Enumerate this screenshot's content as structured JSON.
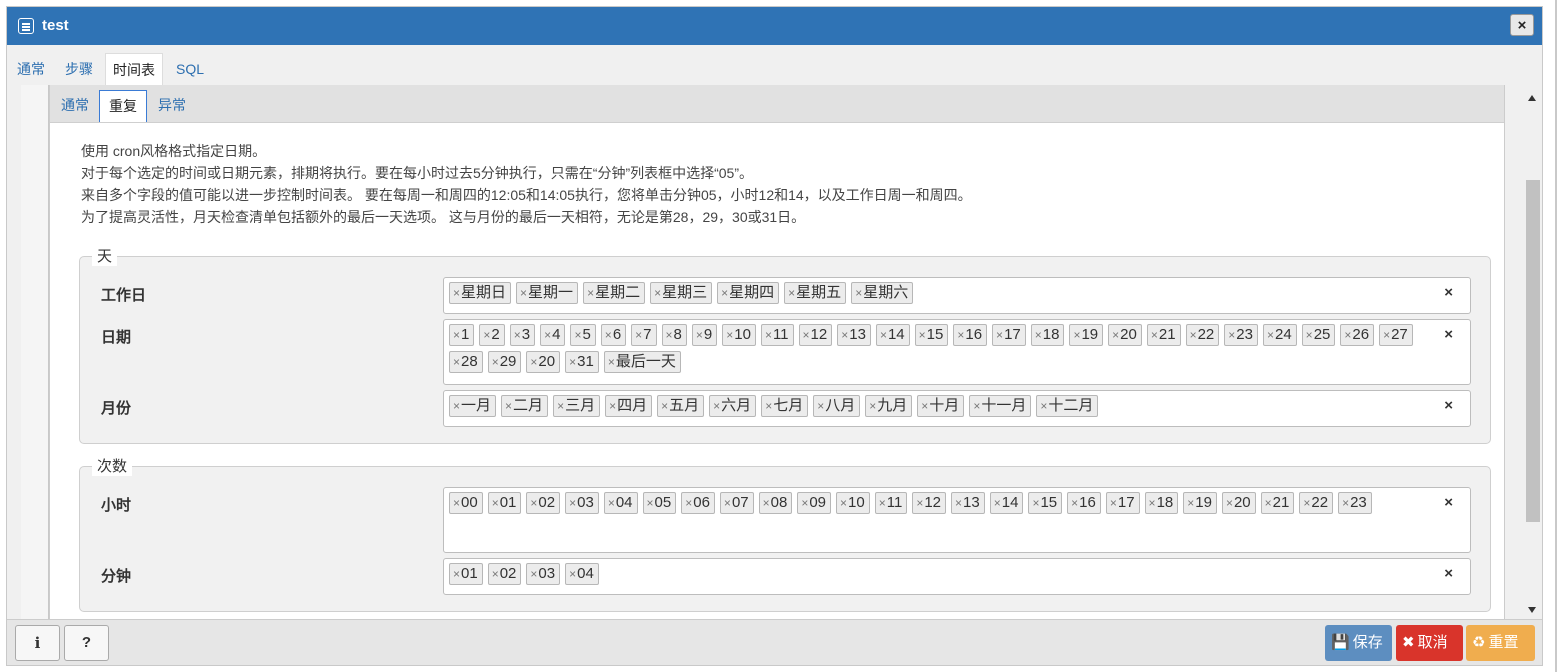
{
  "window": {
    "title": "test",
    "close_label": "×"
  },
  "top_tabs": [
    {
      "label": "通常",
      "active": false
    },
    {
      "label": "步骤",
      "active": false
    },
    {
      "label": "时间表",
      "active": true
    },
    {
      "label": "SQL",
      "active": false
    }
  ],
  "sub_tabs": [
    {
      "label": "通常",
      "active": false
    },
    {
      "label": "重复",
      "active": true
    },
    {
      "label": "异常",
      "active": false
    }
  ],
  "description": [
    "使用 cron风格格式指定日期。",
    "对于每个选定的时间或日期元素，排期将执行。要在每小时过去5分钟执行，只需在“分钟”列表框中选择“05”。",
    "来自多个字段的值可能以进一步控制时间表。 要在每周一和周四的12:05和14:05执行，您将单击分钟05，小时12和14，以及工作日周一和周四。",
    "为了提高灵活性，月天检查清单包括额外的最后一天选项。 这与月份的最后一天相符，无论是第28，29，30或31日。"
  ],
  "days_section": {
    "legend": "天",
    "weekdays": {
      "label": "工作日",
      "chips": [
        "星期日",
        "星期一",
        "星期二",
        "星期三",
        "星期四",
        "星期五",
        "星期六"
      ]
    },
    "dates": {
      "label": "日期",
      "chips": [
        "1",
        "2",
        "3",
        "4",
        "5",
        "6",
        "7",
        "8",
        "9",
        "10",
        "11",
        "12",
        "13",
        "14",
        "15",
        "16",
        "17",
        "18",
        "19",
        "20",
        "21",
        "22",
        "23",
        "24",
        "25",
        "26",
        "27",
        "28",
        "29",
        "20",
        "31",
        "最后一天"
      ]
    },
    "months": {
      "label": "月份",
      "chips": [
        "一月",
        "二月",
        "三月",
        "四月",
        "五月",
        "六月",
        "七月",
        "八月",
        "九月",
        "十月",
        "十一月",
        "十二月"
      ]
    }
  },
  "times_section": {
    "legend": "次数",
    "hours": {
      "label": "小时",
      "chips": [
        "00",
        "01",
        "02",
        "03",
        "04",
        "05",
        "06",
        "07",
        "08",
        "09",
        "10",
        "11",
        "12",
        "13",
        "14",
        "15",
        "16",
        "17",
        "18",
        "19",
        "20",
        "21",
        "22",
        "23"
      ]
    },
    "minutes": {
      "label": "分钟",
      "chips": [
        "01",
        "02",
        "03",
        "04"
      ]
    }
  },
  "chip_remove_glyph": "×",
  "clear_glyph": "×",
  "footer": {
    "info_label": "i",
    "help_label": "?",
    "save_label": "保存",
    "cancel_label": "取消",
    "reset_label": "重置"
  },
  "colors": {
    "titlebar": "#2f73b5",
    "save": "#5d8ec0",
    "cancel": "#d9342b",
    "reset": "#f0ad4e",
    "link": "#2d6fb0"
  }
}
